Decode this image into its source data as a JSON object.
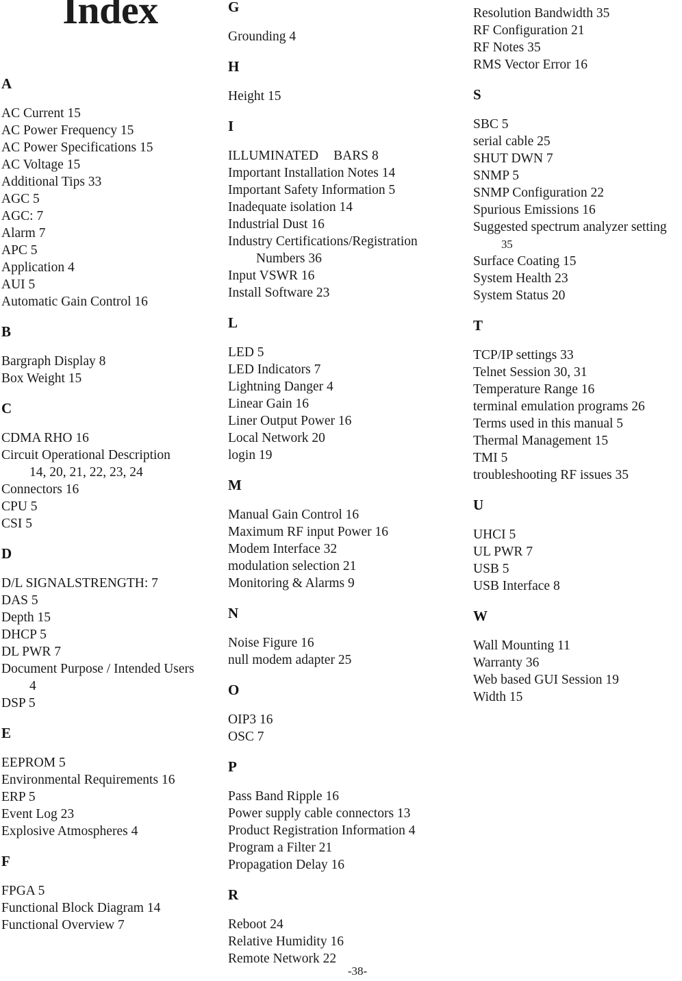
{
  "document": {
    "title": "Index",
    "footer_page_label": "-38-"
  },
  "columns": [
    {
      "id": "column-1",
      "groups": [
        {
          "letter": "A",
          "entries": [
            {
              "text": "AC Current  15"
            },
            {
              "text": "AC Power Frequency  15"
            },
            {
              "text": "AC Power Specifications  15"
            },
            {
              "text": "AC Voltage  15"
            },
            {
              "text": "Additional Tips  33"
            },
            {
              "text": "AGC 5"
            },
            {
              "text": "AGC: 7"
            },
            {
              "text": "Alarm  7"
            },
            {
              "text": "APC 5"
            },
            {
              "text": "Application  4"
            },
            {
              "text": "AUI 5"
            },
            {
              "text": "Automatic Gain Control  16"
            }
          ]
        },
        {
          "letter": "B",
          "entries": [
            {
              "text": "Bargraph Display  8"
            },
            {
              "text": "Box Weight  15"
            }
          ]
        },
        {
          "letter": "C",
          "entries": [
            {
              "text": "CDMA RHO  16"
            },
            {
              "text": "Circuit Operational Description"
            },
            {
              "text": "14,  20,  21,  22,  23,  24",
              "continuation": true
            },
            {
              "text": "Connectors  16"
            },
            {
              "text": "CPU 5"
            },
            {
              "text": "CSI 5"
            }
          ]
        },
        {
          "letter": "D",
          "entries": [
            {
              "text": "D/L SIGNALSTRENGTH: 7"
            },
            {
              "text": "DAS  5"
            },
            {
              "text": "Depth  15"
            },
            {
              "text": "DHCP 5"
            },
            {
              "text": "DL PWR  7"
            },
            {
              "text": "Document Purpose / Intended Users"
            },
            {
              "text": "4",
              "continuation": true
            },
            {
              "text": "DSP  5"
            }
          ]
        },
        {
          "letter": "E",
          "entries": [
            {
              "text": "EEPROM 5"
            },
            {
              "text": "Environmental Requirements  16"
            },
            {
              "text": "ERP 5"
            },
            {
              "text": "Event Log  23"
            },
            {
              "text": "Explosive Atmospheres  4"
            }
          ]
        },
        {
          "letter": "F",
          "entries": [
            {
              "text": "FPGA  5"
            },
            {
              "text": "Functional Block Diagram  14"
            },
            {
              "text": "Functional Overview  7"
            }
          ]
        }
      ]
    },
    {
      "id": "column-2",
      "groups": [
        {
          "letter": "G",
          "entries": [
            {
              "text": "Grounding  4"
            }
          ]
        },
        {
          "letter": "H",
          "entries": [
            {
              "text": "Height  15"
            }
          ]
        },
        {
          "letter": "I",
          "entries": [
            {
              "text": "ILLUMINATED",
              "text2": "BARS 8",
              "wide_gap": true
            },
            {
              "text": "Important Installation Notes  14"
            },
            {
              "text": "Important Safety Information  5"
            },
            {
              "text": "Inadequate isolation  14"
            },
            {
              "text": "Industrial Dust  16"
            },
            {
              "text": "Industry Certifications/Registration"
            },
            {
              "text": "Numbers  36",
              "continuation": true
            },
            {
              "text": "Input VSWR  16"
            },
            {
              "text": "Install Software  23"
            }
          ]
        },
        {
          "letter": "L",
          "entries": [
            {
              "text": "LED 5"
            },
            {
              "text": "LED Indicators  7"
            },
            {
              "text": "Lightning Danger  4"
            },
            {
              "text": "Linear Gain  16"
            },
            {
              "text": "Liner Output Power  16"
            },
            {
              "text": "Local Network  20"
            },
            {
              "text": "login  19"
            }
          ]
        },
        {
          "letter": "M",
          "entries": [
            {
              "text": "Manual Gain Control  16"
            },
            {
              "text": "Maximum RF input Power  16"
            },
            {
              "text": "Modem Interface  32"
            },
            {
              "text": "modulation selection  21"
            },
            {
              "text": "Monitoring & Alarms  9"
            }
          ]
        },
        {
          "letter": "N",
          "entries": [
            {
              "text": "Noise Figure  16"
            },
            {
              "text": "null modem adapter  25"
            }
          ]
        },
        {
          "letter": "O",
          "entries": [
            {
              "text": "OIP3 16"
            },
            {
              "text": "OSC 7"
            }
          ]
        },
        {
          "letter": "P",
          "entries": [
            {
              "text": "Pass Band Ripple  16"
            },
            {
              "text": "Power supply cable connectors  13"
            },
            {
              "text": "Product Registration Information  4"
            },
            {
              "text": "Program a Filter  21"
            },
            {
              "text": "Propagation Delay  16"
            }
          ]
        },
        {
          "letter": "R",
          "entries": [
            {
              "text": "Reboot  24"
            },
            {
              "text": "Relative Humidity  16"
            },
            {
              "text": "Remote Network  22"
            }
          ]
        }
      ]
    },
    {
      "id": "column-3",
      "groups": [
        {
          "letter": "",
          "entries": [
            {
              "text": "Resolution Bandwidth  35"
            },
            {
              "text": "RF Configuration  21"
            },
            {
              "text": "RF Notes  35"
            },
            {
              "text": "RMS Vector Error  16"
            }
          ]
        },
        {
          "letter": "S",
          "entries": [
            {
              "text": "SBC 5"
            },
            {
              "text": "serial cable  25"
            },
            {
              "text": "SHUT DWN 7"
            },
            {
              "text": "SNMP  5"
            },
            {
              "text": "SNMP Configuration  22"
            },
            {
              "text": "Spurious Emissions  16"
            },
            {
              "text": "Suggested spectrum analyzer setting",
              "overflow": true
            },
            {
              "text": "35",
              "continuation": true,
              "tight": true
            },
            {
              "text": "Surface Coating  15"
            },
            {
              "text": "System Health  23"
            },
            {
              "text": "System Status  20"
            }
          ]
        },
        {
          "letter": "T",
          "entries": [
            {
              "text": "TCP/IP settings  33"
            },
            {
              "text": "Telnet Session  30,  31"
            },
            {
              "text": "Temperature Range  16"
            },
            {
              "text": "terminal emulation programs  26"
            },
            {
              "text": "Terms used in this manual  5"
            },
            {
              "text": "Thermal Management  15"
            },
            {
              "text": "TMI 5"
            },
            {
              "text": "troubleshooting RF issues  35"
            }
          ]
        },
        {
          "letter": "U",
          "entries": [
            {
              "text": "UHCI 5"
            },
            {
              "text": "UL PWR  7"
            },
            {
              "text": "USB 5"
            },
            {
              "text": "USB Interface  8"
            }
          ]
        },
        {
          "letter": "W",
          "entries": [
            {
              "text": "Wall Mounting  11"
            },
            {
              "text": "Warranty  36"
            },
            {
              "text": "Web based GUI Session  19"
            },
            {
              "text": "Width  15"
            }
          ]
        }
      ]
    }
  ]
}
